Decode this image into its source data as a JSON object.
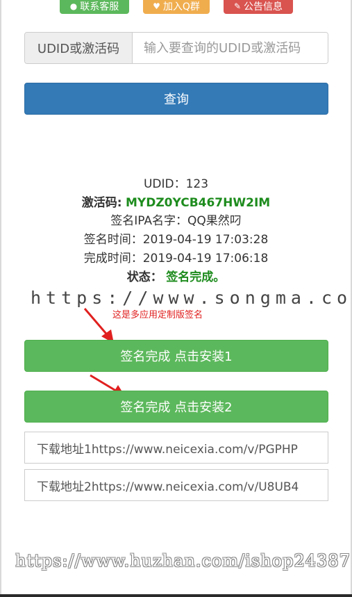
{
  "top_buttons": {
    "service": "联系客服",
    "qq_group": "加入Q群",
    "notice": "公告信息"
  },
  "query": {
    "addon_label": "UDID或激活码",
    "placeholder": "输入要查询的UDID或激活码",
    "submit_label": "查询"
  },
  "result": {
    "udid_label": "UDID：",
    "udid_value": "123",
    "code_label": "激活码:",
    "code_value": "MYDZ0YCB467HW2IM",
    "ipa_label": "签名IPA名字：",
    "ipa_value": "QQ果然叼",
    "sign_time_label": "签名时间：",
    "sign_time_value": "2019-04-19 17:03:28",
    "done_time_label": "完成时间：",
    "done_time_value": "2019-04-19 17:06:18",
    "status_label": "状态：",
    "status_value": "签名完成。"
  },
  "watermark_top": "https://www.songma.com",
  "annotation_note": "这是多应用定制版签名",
  "install_buttons": [
    {
      "label": "签名完成 点击安装1"
    },
    {
      "label": "签名完成 点击安装2"
    }
  ],
  "download_links": [
    {
      "text": "下载地址1https://www.neicexia.com/v/PGPHP"
    },
    {
      "text": "下载地址2https://www.neicexia.com/v/U8UB4"
    }
  ],
  "watermark_bottom": "https://www.huzhan.com/ishop24387",
  "colors": {
    "primary": "#337ab7",
    "success": "#5cb85c",
    "warning": "#f0ad4e",
    "danger": "#d9534f",
    "status_green": "#1e8c1e",
    "annotation_red": "#e0201f"
  }
}
